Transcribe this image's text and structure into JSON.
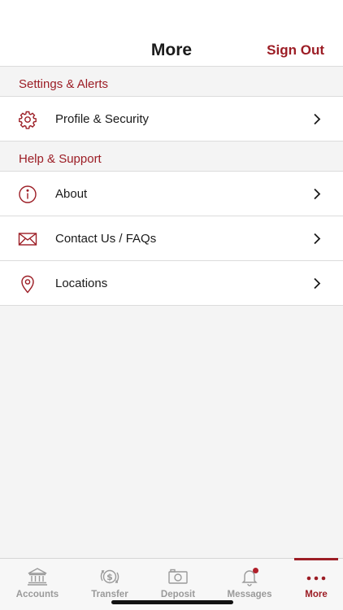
{
  "header": {
    "title": "More",
    "sign_out_label": "Sign Out"
  },
  "sections": [
    {
      "title": "Settings & Alerts",
      "items": [
        {
          "label": "Profile & Security",
          "icon": "gear-icon"
        }
      ]
    },
    {
      "title": "Help & Support",
      "items": [
        {
          "label": "About",
          "icon": "info-icon"
        },
        {
          "label": "Contact Us / FAQs",
          "icon": "envelope-icon"
        },
        {
          "label": "Locations",
          "icon": "location-pin-icon"
        }
      ]
    }
  ],
  "tabbar": {
    "tabs": [
      {
        "label": "Accounts",
        "icon": "bank-icon",
        "active": false
      },
      {
        "label": "Transfer",
        "icon": "money-transfer-icon",
        "active": false
      },
      {
        "label": "Deposit",
        "icon": "camera-icon",
        "active": false
      },
      {
        "label": "Messages",
        "icon": "bell-icon",
        "active": false,
        "has_badge": true
      },
      {
        "label": "More",
        "icon": "more-dots-icon",
        "active": true
      }
    ]
  },
  "colors": {
    "accent": "#9c1d25",
    "text": "#1a1a1a",
    "inactive": "#9a9a9a",
    "background": "#f4f4f4"
  }
}
